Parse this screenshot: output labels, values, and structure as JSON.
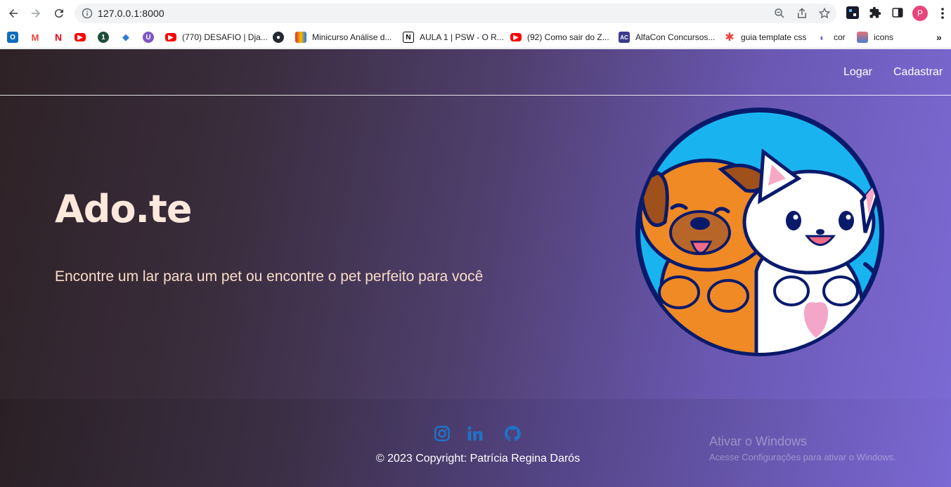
{
  "browser": {
    "url": "127.0.0.1:8000",
    "profile_initial": "P",
    "bookmarks": [
      {
        "icon": "outlook-icon",
        "label": "",
        "color": "#0f6cbd"
      },
      {
        "icon": "gmail-icon",
        "label": "",
        "color": "#ea4335"
      },
      {
        "icon": "netflix-icon",
        "label": "",
        "color": "#e50914"
      },
      {
        "icon": "youtube-icon",
        "label": "",
        "color": "#ff0000"
      },
      {
        "icon": "onepassword-icon",
        "label": "",
        "color": "#1a8754"
      },
      {
        "icon": "stack-icon",
        "label": "",
        "color": "#2e7bcf"
      },
      {
        "icon": "purple-u-icon",
        "label": "",
        "color": "#7e57c2"
      },
      {
        "icon": "youtube-icon",
        "label": "(770) DESAFIO | Dja...",
        "color": "#ff0000"
      },
      {
        "icon": "github-icon",
        "label": "",
        "color": "#24292f"
      },
      {
        "icon": "colorful-icon",
        "label": "Minicurso Análise d...",
        "color": "#d93025"
      },
      {
        "icon": "notion-icon",
        "label": "AULA 1 | PSW - O R...",
        "color": "#000000"
      },
      {
        "icon": "youtube-icon",
        "label": "(92) Como sair do Z...",
        "color": "#ff0000"
      },
      {
        "icon": "alfacon-icon",
        "label": "AlfaCon Concursos...",
        "color": "#3a3a8c"
      },
      {
        "icon": "asterisk-icon",
        "label": "guia template css",
        "color": "#e8453c"
      },
      {
        "icon": "planet-icon",
        "label": "cor",
        "color": "#6b5bd6"
      },
      {
        "icon": "flag-icon",
        "label": "icons",
        "color": "#4a7bd0"
      }
    ]
  },
  "nav": {
    "login_label": "Logar",
    "signup_label": "Cadastrar"
  },
  "hero": {
    "title": "Ado.te",
    "subtitle": "Encontre um lar para um pet ou encontre o pet perfeito para você"
  },
  "footer": {
    "social": [
      "instagram-icon",
      "linkedin-icon",
      "github-icon"
    ],
    "copyright": "© 2023 Copyright: Patrícia Regina Darós"
  },
  "watermark": {
    "title": "Ativar o Windows",
    "subtitle": "Acesse Configurações para ativar o Windows."
  },
  "colors": {
    "accent_link": "#1f73c7",
    "title_color": "#fde8dc",
    "gradient_start": "#2e2226",
    "gradient_end": "#7d6bd6"
  }
}
